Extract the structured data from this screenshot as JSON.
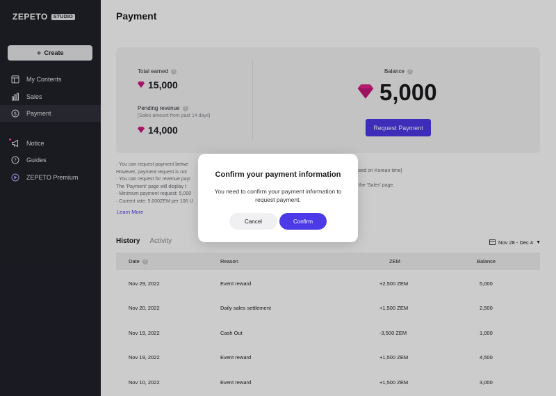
{
  "brand": {
    "name": "ZEPETO",
    "tag": "STUDIO"
  },
  "sidebar": {
    "create_label": "Create",
    "items": [
      {
        "label": "My Contents",
        "icon": "layout-icon"
      },
      {
        "label": "Sales",
        "icon": "bar-chart-icon"
      },
      {
        "label": "Payment",
        "icon": "dollar-circle-icon",
        "active": true
      },
      {
        "label": "Notice",
        "icon": "megaphone-icon"
      },
      {
        "label": "Guides",
        "icon": "question-circle-icon"
      },
      {
        "label": "ZEPETO Premium",
        "icon": "premium-icon"
      }
    ]
  },
  "page": {
    "title": "Payment"
  },
  "summary": {
    "total_earned_label": "Total earned",
    "total_earned_value": "15,000",
    "pending_label": "Pending revenue",
    "pending_sub": "[Sales amount from past 14 days]",
    "pending_value": "14,000",
    "balance_label": "Balance",
    "balance_value": "5,000",
    "request_button": "Request Payment"
  },
  "notes": {
    "line1": "· You can request payment betwe",
    "line2": "  However, payment request is not",
    "line3": "· You can request for revenue payr",
    "line4": "  The 'Payment' page will display t",
    "line5": "· Minimum payment request: 5,000",
    "line6": "· Current rate: 5,000ZEM per 106 U",
    "right1": "ased on Korean time]",
    "right2": "the 'Sales' page.",
    "learn_more": "Learn More"
  },
  "tabs": {
    "history": "History",
    "activity": "Activity"
  },
  "date_filter": {
    "label": "Nov 28 - Dec 4"
  },
  "table": {
    "headers": {
      "date": "Date",
      "reason": "Reason",
      "zem": "ZEM",
      "balance": "Balance"
    },
    "rows": [
      {
        "date": "Nov 29, 2022",
        "reason": "Event reward",
        "zem": "+2,500 ZEM",
        "balance": "5,000"
      },
      {
        "date": "Nov 20, 2022",
        "reason": "Daily sales settlement",
        "zem": "+1,500 ZEM",
        "balance": "2,500"
      },
      {
        "date": "Nov 19, 2022",
        "reason": "Cash Out",
        "zem": "-3,500 ZEM",
        "balance": "1,000"
      },
      {
        "date": "Nov 19, 2022",
        "reason": "Event reward",
        "zem": "+1,500 ZEM",
        "balance": "4,500"
      },
      {
        "date": "Nov 10, 2022",
        "reason": "Event reward",
        "zem": "+1,500 ZEM",
        "balance": "3,000"
      }
    ]
  },
  "modal": {
    "title": "Confirm your payment information",
    "body": "You need to confirm your payment information to request payment.",
    "cancel": "Cancel",
    "confirm": "Confirm"
  },
  "colors": {
    "accent": "#4b3ae6",
    "sidebar_bg": "#21222a",
    "gem": "#e0248a"
  }
}
